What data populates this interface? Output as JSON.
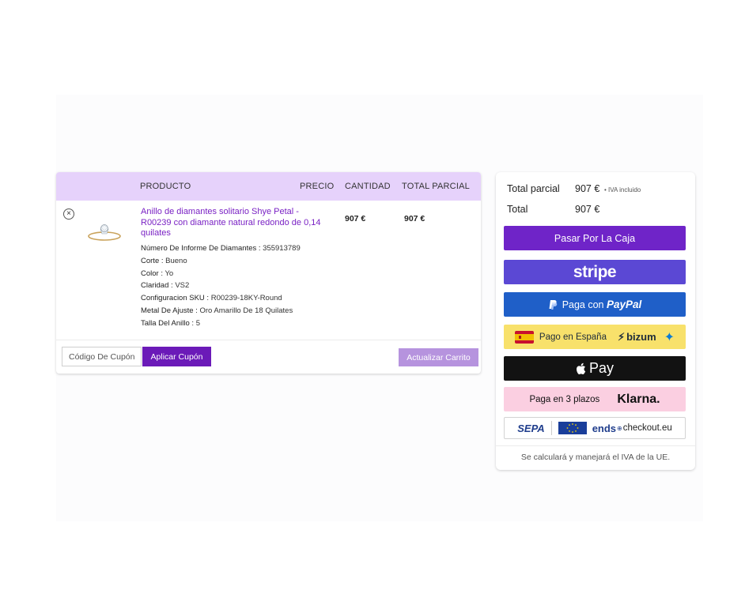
{
  "cart": {
    "headers": {
      "product": "PRODUCTO",
      "price": "PRECIO",
      "quantity": "CANTIDAD",
      "subtotal": "TOTAL PARCIAL"
    },
    "item": {
      "name": "Anillo de diamantes solitario Shye Petal - R00239 con diamante natural redondo de 0,14 quilates",
      "price": "907 €",
      "total": "907 €",
      "meta": [
        {
          "key": "Número De Informe De Diamantes :",
          "value": "355913789"
        },
        {
          "key": "Corte :",
          "value": "Bueno"
        },
        {
          "key": "Color :",
          "value": "Yo"
        },
        {
          "key": "Claridad :",
          "value": "VS2"
        },
        {
          "key": "Configuracion SKU :",
          "value": "R00239-18KY-Round"
        },
        {
          "key": "Metal De Ajuste :",
          "value": "Oro Amarillo De 18 Quilates"
        },
        {
          "key": "Talla Del Anillo :",
          "value": "5"
        }
      ]
    },
    "coupon_placeholder": "Código De Cupón",
    "apply_coupon_label": "Aplicar Cupón",
    "update_cart_label": "Actualizar Carrito"
  },
  "totals": {
    "subtotal_label": "Total parcial",
    "subtotal_value": "907 €",
    "tax_note": "IVA incluido",
    "total_label": "Total",
    "total_value": "907 €",
    "checkout_label": "Pasar Por La Caja",
    "stripe_label": "stripe",
    "paypal_prefix": "Paga con",
    "paypal_brand": "PayPal",
    "bizum_text": "Pago en España",
    "bizum_brand": "bizum",
    "applepay_label": "Pay",
    "klarna_text": "Paga en 3 plazos",
    "klarna_brand": "Klarna.",
    "sepa_label": "SEPA",
    "ends_label": "ends",
    "checkout_eu": "checkout.eu",
    "notice": "Se calculará y manejará el IVA de la UE."
  },
  "colors": {
    "accent": "#6b1ab8",
    "header_bg": "#e6d2fb",
    "link": "#7a22c4",
    "stripe": "#5b48d4",
    "paypal": "#1f5fc8",
    "bizum": "#f8e16b",
    "klarna": "#fbcfe1"
  },
  "icons": [
    "remove-icon",
    "ring-thumbnail",
    "paypal-icon",
    "spain-flag-icon",
    "bizum-icon",
    "caixa-star-icon",
    "apple-icon",
    "eu-flag-icon"
  ]
}
